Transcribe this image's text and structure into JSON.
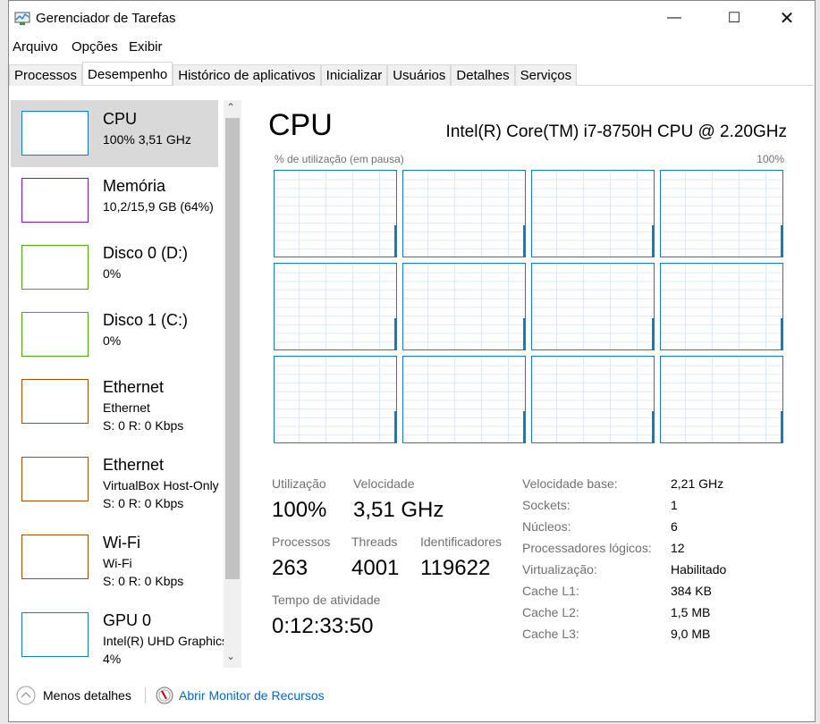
{
  "window": {
    "title": "Gerenciador de Tarefas",
    "controls": [
      "minimize",
      "maximize",
      "close"
    ]
  },
  "menu": [
    "Arquivo",
    "Opções",
    "Exibir"
  ],
  "tabs": [
    "Processos",
    "Desempenho",
    "Histórico de aplicativos",
    "Inicializar",
    "Usuários",
    "Detalhes",
    "Serviços"
  ],
  "active_tab": "Desempenho",
  "sidebar": [
    {
      "name": "CPU",
      "sub": [
        "100% 3,51 GHz"
      ],
      "color": "#117dbb",
      "selected": true
    },
    {
      "name": "Memória",
      "sub": [
        "10,2/15,9 GB (64%)"
      ],
      "color": "#8b12ae"
    },
    {
      "name": "Disco 0 (D:)",
      "sub": [
        "0%"
      ],
      "color": "#4da60c"
    },
    {
      "name": "Disco 1 (C:)",
      "sub": [
        "0%"
      ],
      "color": "#4da60c"
    },
    {
      "name": "Ethernet",
      "sub": [
        "Ethernet",
        "S: 0 R: 0 Kbps"
      ],
      "color": "#a74f01"
    },
    {
      "name": "Ethernet",
      "sub": [
        "VirtualBox Host-Only",
        "S: 0 R: 0 Kbps"
      ],
      "color": "#a74f01"
    },
    {
      "name": "Wi-Fi",
      "sub": [
        "Wi-Fi",
        "S: 0 R: 0 Kbps"
      ],
      "color": "#a74f01"
    },
    {
      "name": "GPU 0",
      "sub": [
        "Intel(R) UHD Graphics",
        "4%"
      ],
      "color": "#117dbb"
    }
  ],
  "main": {
    "title": "CPU",
    "model": "Intel(R) Core(TM) i7-8750H CPU @ 2.20GHz",
    "graph_label": "% de utilização (em pausa)",
    "graph_max": "100%",
    "graph_count": 12,
    "stats": {
      "util_label": "Utilização",
      "util": "100%",
      "speed_label": "Velocidade",
      "speed": "3,51 GHz",
      "proc_label": "Processos",
      "proc": "263",
      "threads_label": "Threads",
      "threads": "4001",
      "handles_label": "Identificadores",
      "handles": "119622",
      "uptime_label": "Tempo de atividade",
      "uptime": "0:12:33:50"
    },
    "details": [
      [
        "Velocidade base:",
        "2,21 GHz"
      ],
      [
        "Sockets:",
        "1"
      ],
      [
        "Núcleos:",
        "6"
      ],
      [
        "Processadores lógicos:",
        "12"
      ],
      [
        "Virtualização:",
        "Habilitado"
      ],
      [
        "Cache L1:",
        "384 KB"
      ],
      [
        "Cache L2:",
        "1,5 MB"
      ],
      [
        "Cache L3:",
        "9,0 MB"
      ]
    ]
  },
  "footer": {
    "less_details": "Menos detalhes",
    "resource_monitor": "Abrir Monitor de Recursos"
  },
  "colors": {
    "accent": "#117dbb",
    "link": "#0066cc"
  }
}
